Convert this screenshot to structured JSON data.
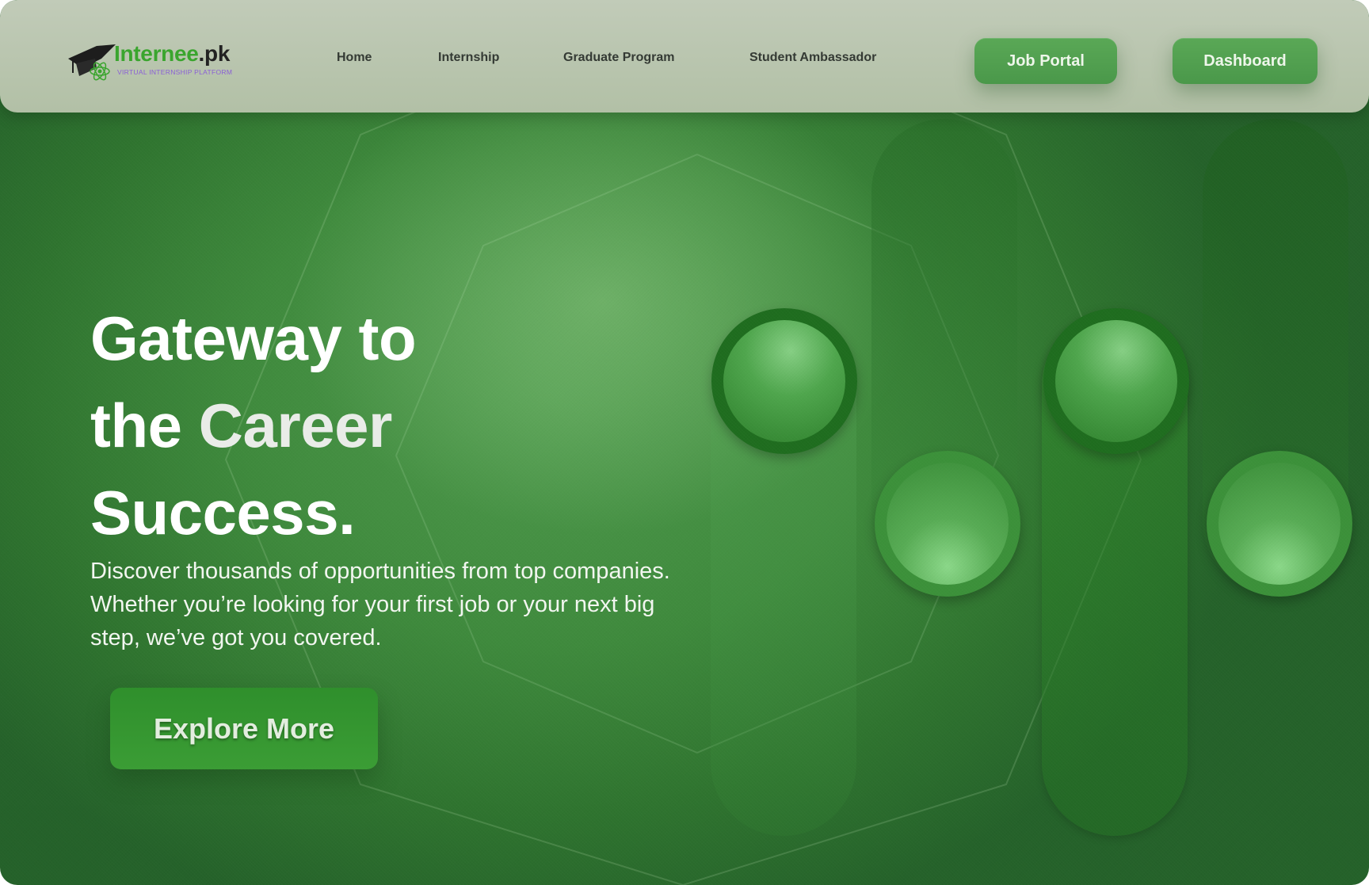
{
  "brand": {
    "name": "Internee",
    "tld": ".pk",
    "tagline": "VIRTUAL INTERNSHIP PLATFORM",
    "logo_icon": "graduation-cap-atom-icon",
    "primary_color": "#3aa52e",
    "tagline_color": "#8a5fd6"
  },
  "nav": {
    "links": [
      {
        "label": "Home"
      },
      {
        "label": "Internship"
      },
      {
        "label": "Graduate Program"
      },
      {
        "label": "Student Ambassador"
      }
    ],
    "job_portal_label": "Job Portal",
    "dashboard_label": "Dashboard"
  },
  "hero": {
    "title_line1": "Gateway to",
    "title_line2_a": "the ",
    "title_line2_b": "Career",
    "title_line3": "Success.",
    "subtitle": "Discover thousands of opportunities from top companies. Whether you’re looking for your first job or your next big step, we’ve got you covered.",
    "cta_label": "Explore More",
    "background_color": "#3f8a3d"
  }
}
